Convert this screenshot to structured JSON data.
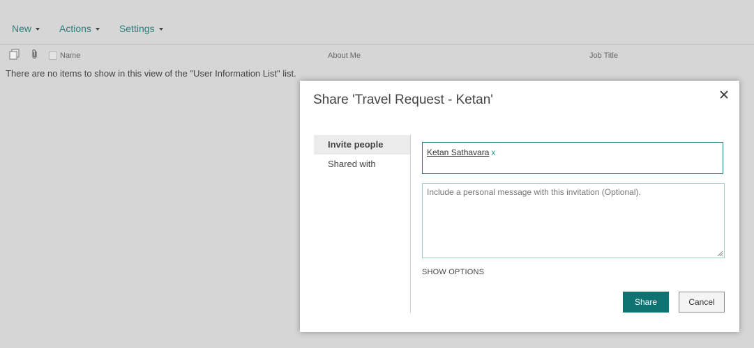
{
  "toolbar": {
    "new_label": "New",
    "actions_label": "Actions",
    "settings_label": "Settings"
  },
  "list": {
    "columns": {
      "name": "Name",
      "about_me": "About Me",
      "job_title": "Job Title"
    },
    "empty_message": "There are no items to show in this view of the \"User Information List\" list."
  },
  "dialog": {
    "title": "Share 'Travel Request - Ketan'",
    "nav": {
      "invite_people": "Invite people",
      "shared_with": "Shared with"
    },
    "invitee": {
      "name": "Ketan Sathavara",
      "remove": "x"
    },
    "message_placeholder": "Include a personal message with this invitation (Optional).",
    "show_options": "SHOW OPTIONS",
    "share_button": "Share",
    "cancel_button": "Cancel"
  },
  "colors": {
    "accent": "#2a7f7a",
    "share_button_bg": "#0f7272",
    "page_bg": "#d6d6d6"
  }
}
